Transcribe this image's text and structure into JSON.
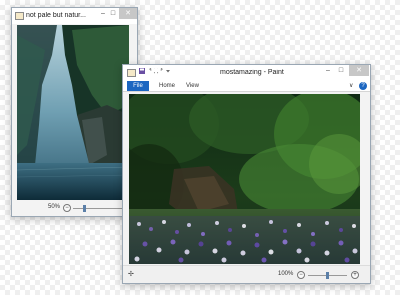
{
  "left_window": {
    "title": "not pale but natur...",
    "minimize": "–",
    "maximize": "□",
    "close": "✕",
    "zoom_label": "50%"
  },
  "paint_window": {
    "title": "mostamazing - Paint",
    "minimize": "–",
    "maximize": "□",
    "close": "✕",
    "tabs": [
      "File",
      "Home",
      "View"
    ],
    "ribbon_collapse": "∨",
    "help": "?",
    "zoom_label": "100%",
    "zoom_out": "−",
    "zoom_in": "+"
  },
  "colors": {
    "file_tab": "#1c66c1",
    "close_button": "#c7c7c7",
    "window_border": "#9aa7b4"
  }
}
